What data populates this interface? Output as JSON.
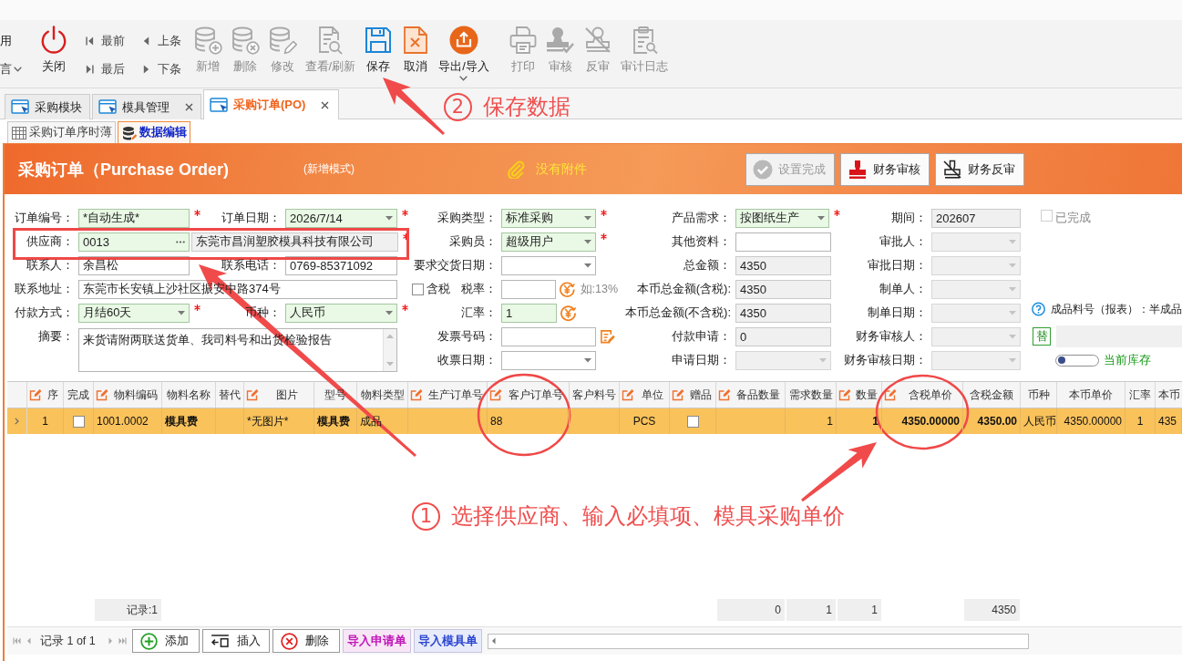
{
  "toolbar": {
    "cut_items": [
      {
        "label": "用",
        "has_menu": false
      },
      {
        "label": "言",
        "has_menu": true
      }
    ],
    "close": {
      "label": "关闭"
    },
    "navigation": [
      {
        "label": "最前",
        "kind": "first"
      },
      {
        "label": "最后",
        "kind": "last"
      },
      {
        "label": "上条",
        "kind": "previous"
      },
      {
        "label": "下条",
        "kind": "next"
      }
    ],
    "actions": [
      {
        "label": "新增",
        "kind": "add",
        "disabled": true,
        "has_menu": false
      },
      {
        "label": "删除",
        "kind": "delete",
        "disabled": true,
        "has_menu": false
      },
      {
        "label": "修改",
        "kind": "edit",
        "disabled": true,
        "has_menu": false
      },
      {
        "label": "查看/刷新",
        "kind": "view",
        "disabled": true,
        "has_menu": false
      },
      {
        "label": "保存",
        "kind": "save",
        "disabled": false,
        "has_menu": false
      },
      {
        "label": "取消",
        "kind": "cancel",
        "disabled": false,
        "has_menu": false
      },
      {
        "label": "导出/导入",
        "kind": "export",
        "disabled": false,
        "has_menu": true
      },
      {
        "label": "打印",
        "kind": "print",
        "disabled": true,
        "has_menu": false
      },
      {
        "label": "审核",
        "kind": "approve",
        "disabled": true,
        "has_menu": false
      },
      {
        "label": "反审",
        "kind": "unapprove",
        "disabled": true,
        "has_menu": false
      },
      {
        "label": "审计日志",
        "kind": "log",
        "disabled": true,
        "has_menu": false
      }
    ]
  },
  "tabs": [
    {
      "label": "采购模块",
      "selected": false,
      "closable": false
    },
    {
      "label": "模具管理",
      "selected": false,
      "closable": true
    },
    {
      "label": "采购订单(PO)",
      "selected": true,
      "closable": true
    }
  ],
  "sub_tabs": [
    {
      "label": "采购订单序时薄",
      "kind": "list",
      "selected": false
    },
    {
      "label": "数据编辑",
      "kind": "edit",
      "selected": true
    }
  ],
  "header": {
    "title": "采购订单（Purchase Order)",
    "mode": "(新增模式)",
    "attachment": "没有附件",
    "buttons": [
      {
        "label": "设置完成",
        "kind": "complete",
        "disabled": true
      },
      {
        "label": "财务审核",
        "kind": "audit",
        "disabled": false
      },
      {
        "label": "财务反审",
        "kind": "unaudit",
        "disabled": false
      }
    ]
  },
  "form": {
    "fields": [
      {
        "label": "订单编号：",
        "value": "*自动生成*",
        "kind": "text",
        "required": true,
        "highlighted": true,
        "disabled": false
      },
      {
        "label": "订单日期：",
        "value": "2026/7/14",
        "kind": "dropdown",
        "required": true,
        "highlighted": true,
        "disabled": false
      },
      {
        "label": "采购类型：",
        "value": "标准采购",
        "kind": "dropdown",
        "required": true,
        "highlighted": true,
        "disabled": false
      },
      {
        "label": "产品需求：",
        "value": "按图纸生产",
        "kind": "dropdown",
        "required": true,
        "highlighted": true,
        "disabled": false
      },
      {
        "label": "期间：",
        "value": "202607",
        "kind": "readonly",
        "required": false,
        "highlighted": false,
        "disabled": false
      },
      {
        "label": "供应商：",
        "value": "0013",
        "detail": "东莞市昌润塑胶模具科技有限公司",
        "kind": "lookup",
        "required": true,
        "highlighted": true,
        "disabled": false
      },
      {
        "label": "采购员：",
        "value": "超级用户",
        "kind": "dropdown",
        "required": true,
        "highlighted": true,
        "disabled": false
      },
      {
        "label": "其他资料：",
        "kind": "text",
        "required": false,
        "highlighted": false,
        "disabled": false
      },
      {
        "label": "审批人：",
        "kind": "dropdown",
        "required": false,
        "highlighted": false,
        "disabled": true
      },
      {
        "label": "联系人：",
        "value": "余昌松",
        "kind": "text",
        "required": false,
        "highlighted": false,
        "disabled": false
      },
      {
        "label": "联系电话：",
        "value": "0769-85371092",
        "kind": "text",
        "required": false,
        "highlighted": false,
        "disabled": false
      },
      {
        "label": "要求交货日期：",
        "kind": "dropdown",
        "required": false,
        "highlighted": false,
        "disabled": false
      },
      {
        "label": "总金额：",
        "value": "4350",
        "kind": "readonly",
        "required": false,
        "highlighted": false,
        "disabled": false
      },
      {
        "label": "审批日期：",
        "kind": "dropdown",
        "required": false,
        "highlighted": false,
        "disabled": true
      },
      {
        "label": "联系地址：",
        "value": "东莞市长安镇上沙社区振安中路374号",
        "kind": "long-text",
        "required": false,
        "highlighted": false,
        "disabled": false
      },
      {
        "label": "税率：",
        "kind": "rate",
        "checkbox": {
          "label": "含税",
          "checked": false
        },
        "hint": "如:13%",
        "required": false,
        "highlighted": false,
        "disabled": false
      },
      {
        "label": "本币总金额(含税):",
        "value": "4350",
        "kind": "readonly",
        "required": false,
        "highlighted": false,
        "disabled": false
      },
      {
        "label": "制单人：",
        "kind": "dropdown",
        "required": false,
        "highlighted": false,
        "disabled": true
      },
      {
        "label": "付款方式：",
        "value": "月结60天",
        "kind": "dropdown",
        "required": true,
        "highlighted": true,
        "disabled": false
      },
      {
        "label": "币种：",
        "value": "人民币",
        "kind": "dropdown",
        "required": true,
        "highlighted": true,
        "disabled": false
      },
      {
        "label": "汇率：",
        "value": "1",
        "kind": "rate",
        "required": false,
        "highlighted": true,
        "disabled": false
      },
      {
        "label": "本币总金额(不含税):",
        "value": "4350",
        "kind": "readonly",
        "required": false,
        "highlighted": false,
        "disabled": false
      },
      {
        "label": "制单日期：",
        "kind": "dropdown",
        "required": false,
        "highlighted": false,
        "disabled": true
      },
      {
        "label": "摘要：",
        "value": "来货请附两联送货单、我司料号和出货检验报告",
        "kind": "textarea",
        "required": false,
        "highlighted": false,
        "disabled": false
      },
      {
        "label": "发票号码：",
        "kind": "note",
        "required": false,
        "highlighted": false,
        "disabled": false
      },
      {
        "label": "付款申请：",
        "value": "0",
        "kind": "readonly",
        "required": false,
        "highlighted": false,
        "disabled": false
      },
      {
        "label": "财务审核人：",
        "kind": "dropdown",
        "required": false,
        "highlighted": false,
        "disabled": true
      },
      {
        "label": "收票日期：",
        "kind": "dropdown",
        "required": false,
        "highlighted": false,
        "disabled": false
      },
      {
        "label": "申请日期：",
        "kind": "dropdown",
        "required": false,
        "highlighted": false,
        "disabled": true
      },
      {
        "label": "财务审核日期：",
        "kind": "dropdown",
        "required": false,
        "highlighted": false,
        "disabled": true
      }
    ],
    "completed": {
      "label": "已完成",
      "checked": false,
      "disabled": true
    },
    "hint": {
      "text": "成品料号（报表）：半成品"
    },
    "replace_button": {
      "label": "替"
    },
    "stock_toggle": {
      "label": "当前库存",
      "on": false
    }
  },
  "table": {
    "columns": [
      {
        "label": "序",
        "editable": true,
        "kind": "center"
      },
      {
        "label": "完成",
        "editable": false,
        "kind": "check"
      },
      {
        "label": "物料编码",
        "editable": true,
        "kind": "text"
      },
      {
        "label": "物料名称",
        "editable": false,
        "kind": "text"
      },
      {
        "label": "替代",
        "editable": false,
        "kind": "text"
      },
      {
        "label": "图片",
        "editable": true,
        "kind": "text"
      },
      {
        "label": "型号",
        "editable": false,
        "kind": "text"
      },
      {
        "label": "物料类型",
        "editable": false,
        "kind": "text"
      },
      {
        "label": "生产订单号",
        "editable": true,
        "kind": "text"
      },
      {
        "label": "客户订单号",
        "editable": true,
        "kind": "text"
      },
      {
        "label": "客户料号",
        "editable": false,
        "kind": "text"
      },
      {
        "label": "单位",
        "editable": true,
        "kind": "center"
      },
      {
        "label": "赠品",
        "editable": true,
        "kind": "check"
      },
      {
        "label": "备品数量",
        "editable": true,
        "kind": "number"
      },
      {
        "label": "需求数量",
        "editable": false,
        "kind": "number"
      },
      {
        "label": "数量",
        "editable": true,
        "kind": "number"
      },
      {
        "label": "含税单价",
        "editable": true,
        "kind": "number"
      },
      {
        "label": "含税金额",
        "editable": false,
        "kind": "number"
      },
      {
        "label": "币种",
        "editable": false,
        "kind": "text"
      },
      {
        "label": "本币单价",
        "editable": false,
        "kind": "number"
      },
      {
        "label": "汇率",
        "editable": false,
        "kind": "center"
      },
      {
        "label": "本币",
        "editable": false,
        "kind": "text"
      }
    ],
    "rows": [
      {
        "selected": true,
        "cells": [
          {
            "text": "1"
          },
          {
            "checked": false
          },
          {
            "text": "1001.0002"
          },
          {
            "text": "模具费"
          },
          {},
          {
            "text": "*无图片*"
          },
          {
            "text": "模具费"
          },
          {
            "text": "成品"
          },
          {},
          {
            "text": "88"
          },
          {},
          {
            "text": "PCS"
          },
          {
            "checked": false
          },
          {},
          {
            "text": "1"
          },
          {
            "text": "1"
          },
          {
            "text": "4350.00000"
          },
          {
            "text": "4350.00"
          },
          {
            "text": "人民币"
          },
          {
            "text": "4350.00000"
          },
          {
            "text": "1"
          },
          {
            "text": "435"
          }
        ]
      }
    ],
    "summary": [
      {
        "text": "记录:1"
      },
      {
        "text": "0"
      },
      {
        "text": "1"
      },
      {
        "text": "1"
      },
      {
        "text": "4350"
      }
    ]
  },
  "navigator": {
    "record_text": "记录 1 of 1",
    "buttons": [
      {
        "label": "添加",
        "kind": "add"
      },
      {
        "label": "插入",
        "kind": "insert"
      },
      {
        "label": "删除",
        "kind": "delete"
      },
      {
        "label": "导入申请单",
        "kind": "import",
        "color": "#c018b8"
      },
      {
        "label": "导入模具单",
        "kind": "import",
        "color": "#2c48d0"
      }
    ]
  },
  "annotations": [
    {
      "number": "2",
      "text": "保存数据"
    },
    {
      "number": "1",
      "text": "选择供应商、输入必填项、模具采购单价"
    }
  ]
}
